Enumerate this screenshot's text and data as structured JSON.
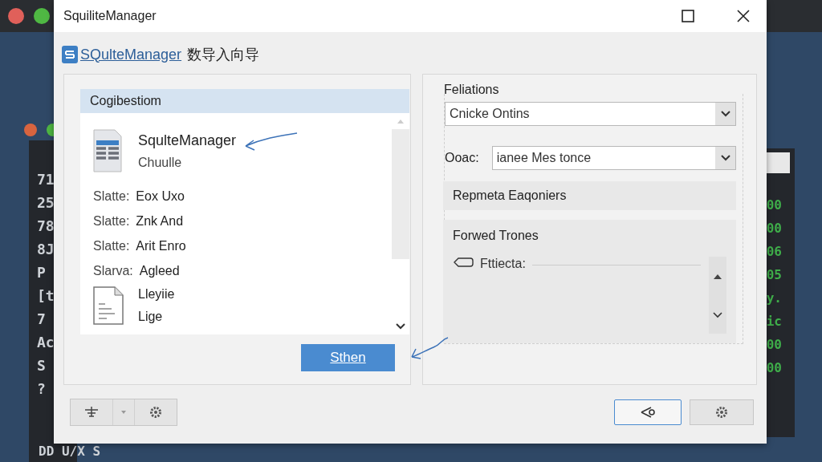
{
  "background": {
    "left_lines": [
      "71",
      "25",
      "78",
      "8J",
      "P",
      "[t",
      "7",
      "Ac",
      "S",
      "?"
    ],
    "right_lines": [
      "00",
      "00",
      "06",
      "05",
      "y.",
      "ic",
      "00",
      "00"
    ],
    "bottom_text": "DD U/X S"
  },
  "window": {
    "title": "SquiliteManager"
  },
  "header": {
    "link": "SQulteManager",
    "title": "数导入向导"
  },
  "left_panel": {
    "heading": "Cogibestiom",
    "app": {
      "name": "SqulteManager",
      "subtitle": "Chuulle"
    },
    "fields": [
      {
        "label": "Slatte:",
        "value": "Eox Uxo"
      },
      {
        "label": "Slatte:",
        "value": "Znk And"
      },
      {
        "label": "Slatte:",
        "value": "Arit Enro"
      },
      {
        "label": "Slarva:",
        "value": "Agleed"
      }
    ],
    "file": {
      "lines": [
        "Lleyiie",
        "Lige"
      ]
    },
    "button": "Sthen"
  },
  "right_panel": {
    "group_label": "Feliations",
    "dropdown": "Cnicke Ontins",
    "option": {
      "label": "Ooac:",
      "value": "ianee Mes tonce"
    },
    "sections": [
      "Repmeta Eaqoniers",
      "Forwed Trones"
    ],
    "item": "Fttiecta:"
  }
}
